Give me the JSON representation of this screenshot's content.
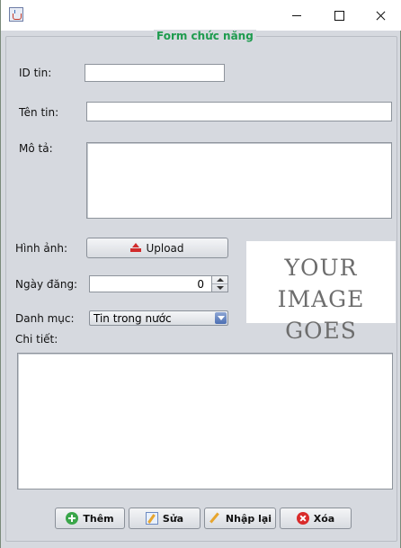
{
  "form": {
    "title": "Form chức năng",
    "id_label": "ID tin:",
    "id_value": "",
    "name_label": "Tên tin:",
    "name_value": "",
    "desc_label": "Mô tả:",
    "image_label": "Hình ảnh:",
    "upload_label": "Upload",
    "date_label": "Ngày đăng:",
    "date_value": "0",
    "category_label": "Danh mục:",
    "category_value": "Tin trong nước",
    "detail_label": "Chi tiết:",
    "image_placeholder": "YOUR IMAGE\nGOES HERE"
  },
  "buttons": {
    "add": "Thêm",
    "edit": "Sửa",
    "reset": "Nhập lại",
    "delete": "Xóa"
  },
  "colors": {
    "title_green": "#1e9b4e",
    "window_bg": "#d6d9df",
    "upload_icon": "#d12b2b"
  }
}
